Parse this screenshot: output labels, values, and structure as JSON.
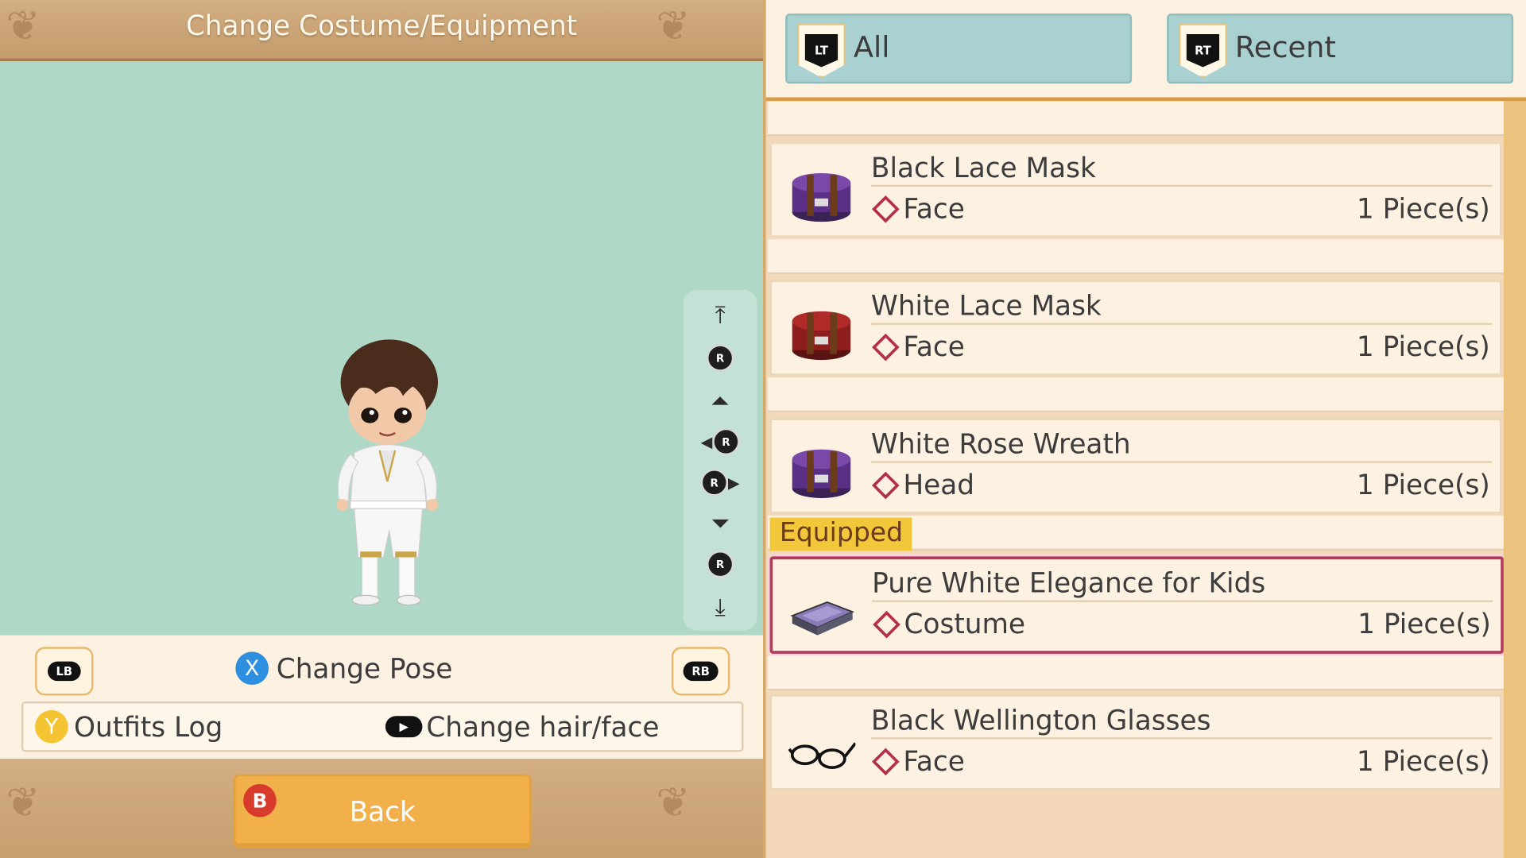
{
  "header": {
    "title": "Change Costume/Equipment"
  },
  "controls": {
    "lb_label": "LB",
    "rb_label": "RB",
    "x_label": "X",
    "change_pose": "Change Pose",
    "y_label": "Y",
    "outfits_log": "Outfits Log",
    "change_hair_face": "Change hair/face"
  },
  "rail": {
    "icons": [
      "scroll-top-icon",
      "rotate-up-icon",
      "move-up-icon",
      "rotate-left-icon",
      "rotate-right-icon",
      "move-down-icon",
      "rotate-down-icon",
      "scroll-bottom-icon"
    ],
    "r_label": "R"
  },
  "footer": {
    "b_label": "B",
    "back_label": "Back"
  },
  "tabs": [
    {
      "badge": "LT",
      "label": "All"
    },
    {
      "badge": "RT",
      "label": "Recent"
    }
  ],
  "items": [
    {
      "name": "Black Lace Mask",
      "category": "Face",
      "quantity": "1 Piece(s)",
      "icon": "purple-hatbox-icon"
    },
    {
      "name": "White Lace Mask",
      "category": "Face",
      "quantity": "1 Piece(s)",
      "icon": "red-hatbox-icon"
    },
    {
      "name": "White Rose Wreath",
      "category": "Head",
      "quantity": "1 Piece(s)",
      "icon": "purple-hatbox-icon"
    },
    {
      "name": "Pure White Elegance for Kids",
      "category": "Costume",
      "quantity": "1 Piece(s)",
      "icon": "costume-case-icon",
      "equipped": true
    },
    {
      "name": "Black Wellington Glasses",
      "category": "Face",
      "quantity": "1 Piece(s)",
      "icon": "glasses-icon"
    }
  ],
  "equipped_label": "Equipped",
  "colors": {
    "accent": "#f1b04a",
    "selected_border": "#b4395a",
    "preview_bg": "#afd8c6",
    "tab_bg": "#a9d1d1"
  }
}
